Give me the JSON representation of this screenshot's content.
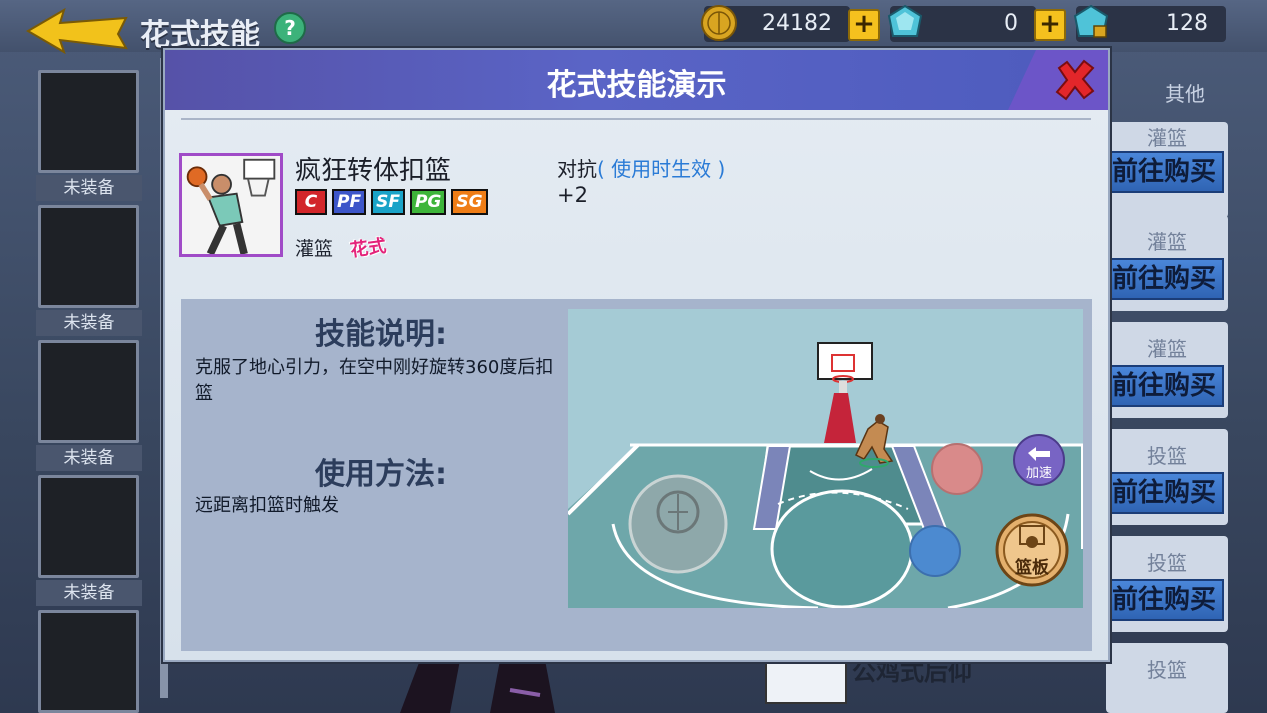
{
  "header": {
    "page_title": "花式技能",
    "help_label": "?"
  },
  "currency": [
    {
      "name": "coin",
      "value": "24182"
    },
    {
      "name": "diamond",
      "value": "0"
    },
    {
      "name": "locked-diamond",
      "value": "128"
    }
  ],
  "plus_label": "+",
  "slots": [
    {
      "label": "未装备"
    },
    {
      "label": "未装备"
    },
    {
      "label": "未装备"
    },
    {
      "label": "未装备"
    }
  ],
  "right_tab": "其他",
  "right_list": [
    {
      "category": "灌篮",
      "button": "前往购买"
    },
    {
      "category": "灌篮",
      "button": "前往购买"
    },
    {
      "category": "灌篮",
      "button": "前往购买"
    },
    {
      "category": "投篮",
      "button": "前往购买"
    },
    {
      "category": "投篮",
      "button": "前往购买"
    },
    {
      "category": "投篮",
      "button": ""
    }
  ],
  "bottom_item": "公鸡式后仰",
  "modal": {
    "title": "花式技能演示",
    "skill": {
      "name": "疯狂转体扣篮",
      "positions": [
        {
          "label": "C",
          "color": "#d2262a"
        },
        {
          "label": "PF",
          "color": "#3d56c9"
        },
        {
          "label": "SF",
          "color": "#1aa3c8"
        },
        {
          "label": "PG",
          "color": "#3eb53a"
        },
        {
          "label": "SG",
          "color": "#ef7d16"
        }
      ],
      "type": "灌篮",
      "badge": "花式"
    },
    "effect": {
      "label": "对抗",
      "hint": "( 使用时生效 )",
      "value": "+2"
    },
    "description_title": "技能说明:",
    "description_text": "克服了地心引力，在空中刚好旋转360度后扣篮",
    "usage_title": "使用方法:",
    "usage_text": "远距离扣篮时触发",
    "video": {
      "speed_label": "加速",
      "rebound_label": "篮板"
    }
  }
}
